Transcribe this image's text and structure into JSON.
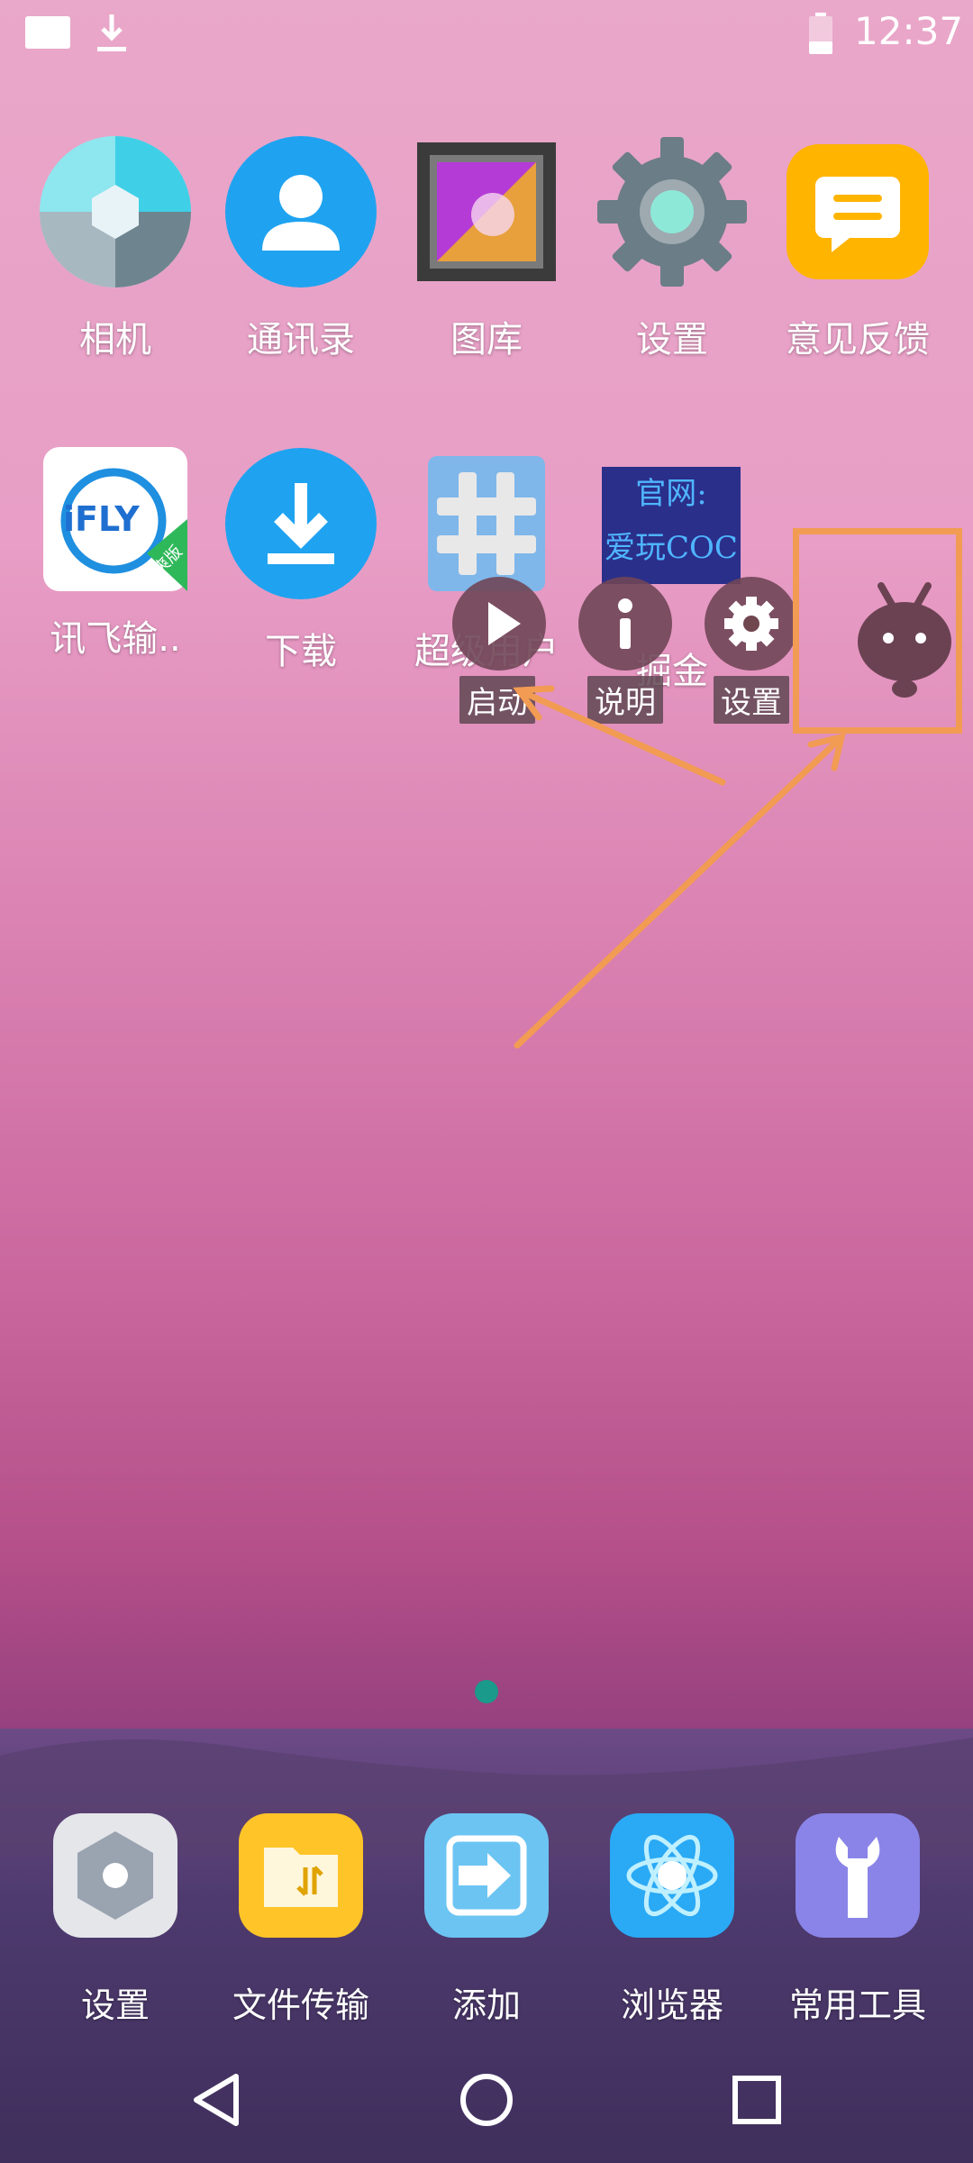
{
  "status_bar": {
    "time": "12:37",
    "left_icons": [
      "image-icon",
      "download-icon"
    ],
    "right_icons": [
      "battery-icon"
    ]
  },
  "apps_row1": [
    {
      "label": "相机",
      "icon": "camera-icon"
    },
    {
      "label": "通讯录",
      "icon": "contacts-icon"
    },
    {
      "label": "图库",
      "icon": "gallery-icon"
    },
    {
      "label": "设置",
      "icon": "settings-gear-icon"
    },
    {
      "label": "意见反馈",
      "icon": "feedback-icon"
    }
  ],
  "apps_row2": [
    {
      "label": "讯飞输..",
      "icon": "ifly-input-icon",
      "icon_text": "iFLY",
      "badge": "清爽版"
    },
    {
      "label": "下载",
      "icon": "download-app-icon"
    },
    {
      "label": "超级用户",
      "icon": "superuser-icon"
    },
    {
      "label": "掘金",
      "icon": "ad-tile-icon",
      "tile_lines": [
        "官网:",
        "爱玩COC"
      ]
    }
  ],
  "float_menu": {
    "items": [
      {
        "label": "启动",
        "icon": "play-icon"
      },
      {
        "label": "说明",
        "icon": "info-icon"
      },
      {
        "label": "设置",
        "icon": "gear-icon"
      }
    ],
    "handle_icon": "bug-mascot-icon"
  },
  "dock": [
    {
      "label": "设置",
      "icon": "dock-settings-icon"
    },
    {
      "label": "文件传输",
      "icon": "file-transfer-icon"
    },
    {
      "label": "添加",
      "icon": "add-icon"
    },
    {
      "label": "浏览器",
      "icon": "browser-icon"
    },
    {
      "label": "常用工具",
      "icon": "tools-icon"
    }
  ],
  "nav": {
    "buttons": [
      "back-icon",
      "home-icon",
      "recents-icon"
    ]
  },
  "colors": {
    "annotation": "#f29b53",
    "page_indicator": "#1a9a8a"
  }
}
